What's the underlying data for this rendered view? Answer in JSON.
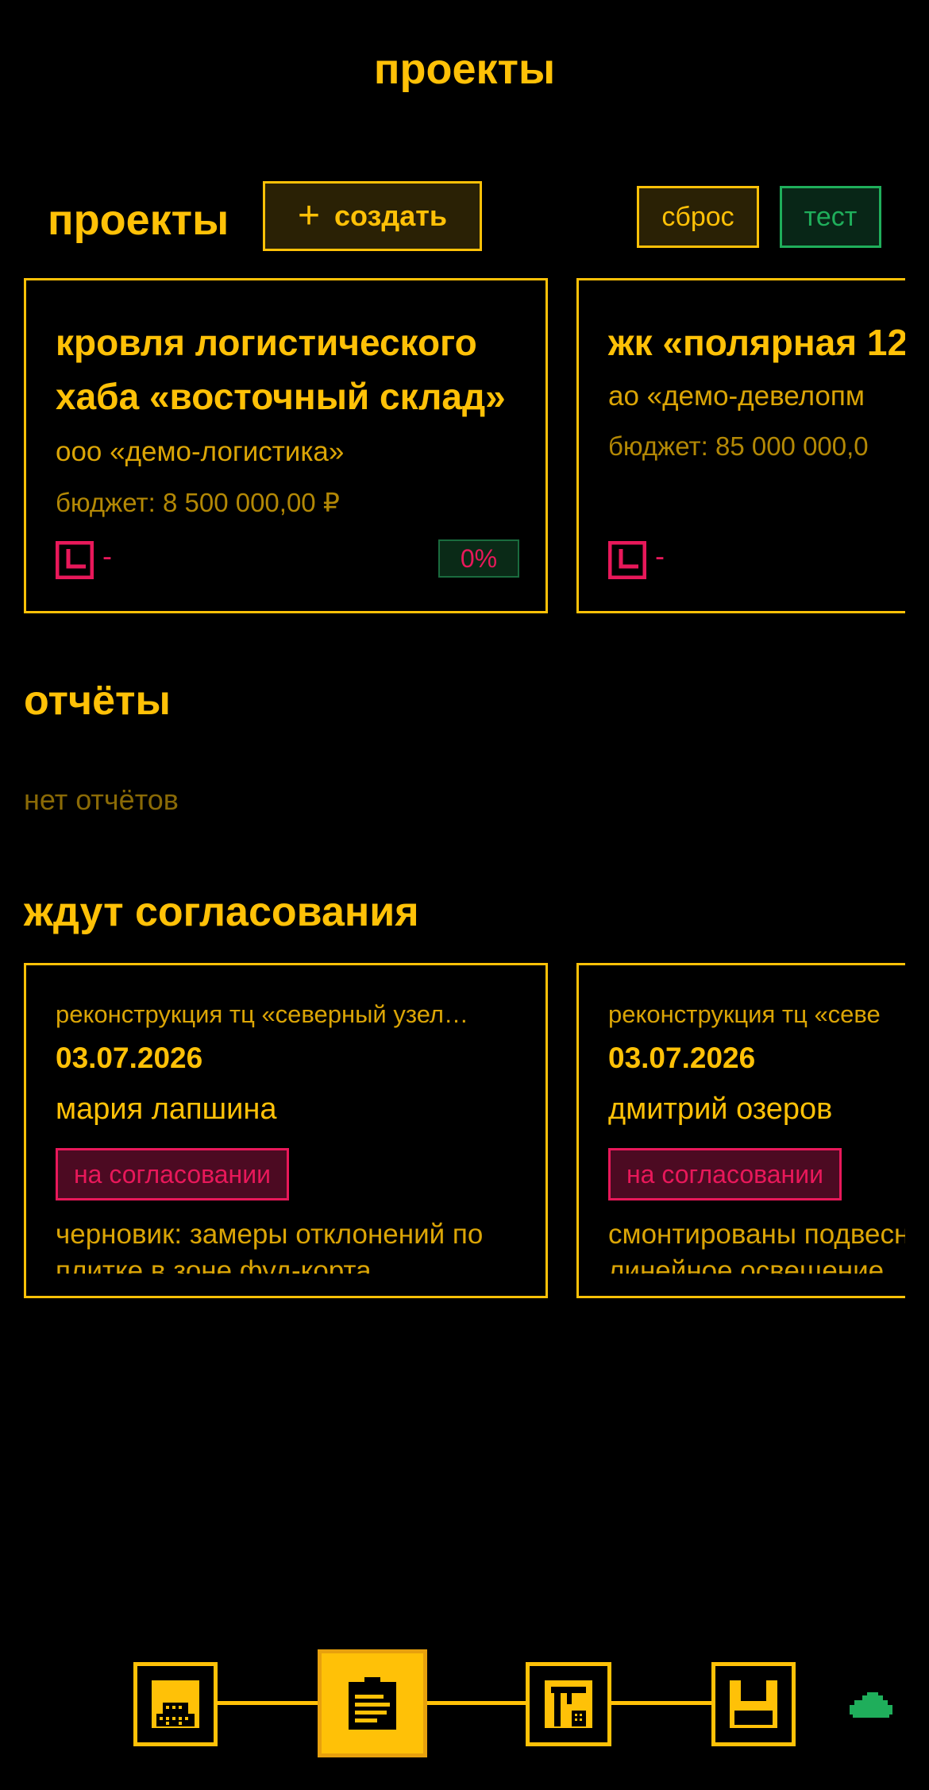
{
  "header": {
    "title": "проекты"
  },
  "projects": {
    "label": "проекты",
    "create_label": "создать",
    "reset_label": "сброс",
    "test_label": "тест",
    "items": [
      {
        "title": "кровля логистического хаба «восточный склад»",
        "org": "ооо «демо-логистика»",
        "budget": "бюджет: 8 500 000,00 ₽",
        "deadline": "-",
        "progress": "0%"
      },
      {
        "title": "жк «полярная 12",
        "org": "ао «демо-девелопм",
        "budget": "бюджет: 85 000 000,0",
        "deadline": "-"
      }
    ]
  },
  "reports": {
    "title": "отчёты",
    "empty_text": "нет отчётов"
  },
  "approvals": {
    "title": "ждут согласования",
    "items": [
      {
        "project": "реконструкция тц «северный узел…",
        "date": "03.07.2026",
        "author": "мария лапшина",
        "status": "на согласовании",
        "description": "черновик: замеры отклонений по плитке в зоне фуд-корта"
      },
      {
        "project": "реконструкция тц «севе",
        "date": "03.07.2026",
        "author": "дмитрий озеров",
        "status": "на согласовании",
        "description": "смонтированы подвесные потолки и линейное освещение"
      }
    ]
  },
  "colors": {
    "accent": "#ffc107",
    "danger": "#e8185a",
    "success": "#1fae5b",
    "background": "#000000"
  },
  "nav": {
    "icons": [
      "building-icon",
      "clipboard-icon",
      "crane-icon",
      "save-icon",
      "cloud-icon"
    ],
    "active_index": 1
  }
}
